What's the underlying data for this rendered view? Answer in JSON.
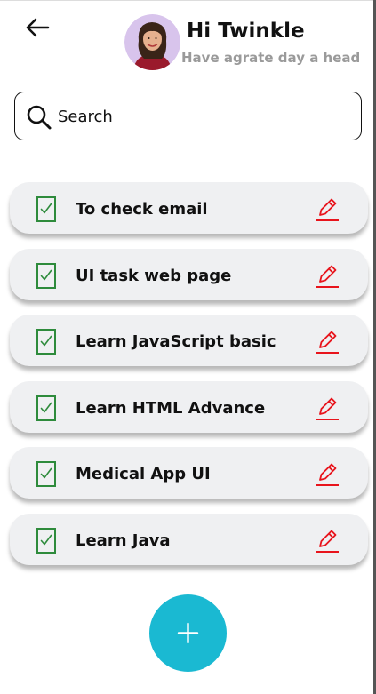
{
  "header": {
    "greeting": "Hi Twinkle",
    "subtitle": "Have agrate day a head",
    "back_icon": "arrow-left-icon"
  },
  "search": {
    "placeholder": "Search",
    "value": "",
    "icon": "search-icon"
  },
  "tasks": [
    {
      "label": "To check email",
      "checked": true
    },
    {
      "label": "UI task web page",
      "checked": true
    },
    {
      "label": "Learn JavaScript basic",
      "checked": true
    },
    {
      "label": "Learn HTML Advance",
      "checked": true
    },
    {
      "label": "Medical App UI",
      "checked": true
    },
    {
      "label": "Learn Java",
      "checked": true
    }
  ],
  "icons": {
    "check": "checkmark-icon",
    "edit": "pencil-icon",
    "add": "plus-icon"
  },
  "colors": {
    "check_green": "#2e8b3c",
    "edit_red": "#e8141c",
    "fab_cyan": "#1ab9d2",
    "card_bg": "#eff0f2",
    "subtitle_gray": "#9a9a9a"
  }
}
